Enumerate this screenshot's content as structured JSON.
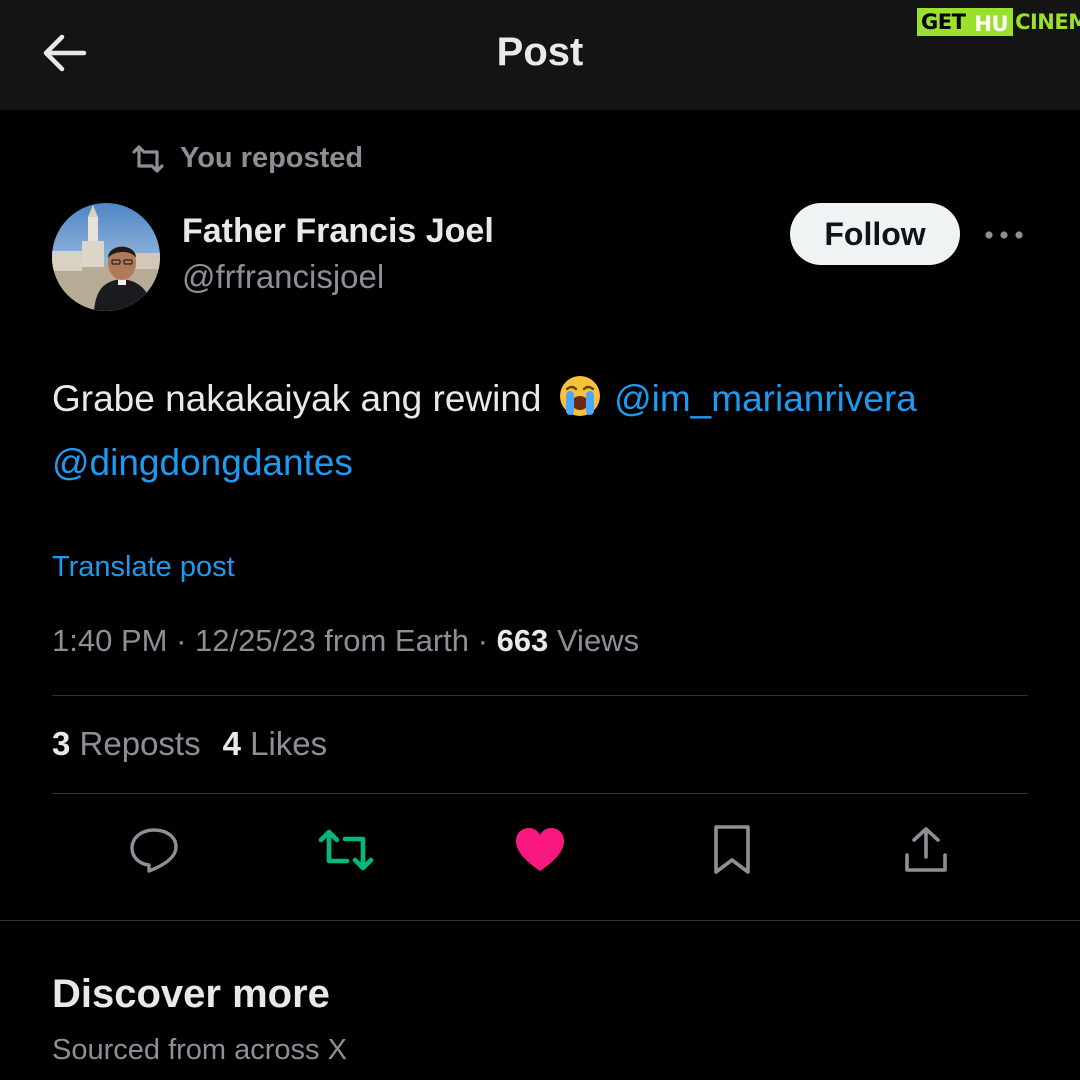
{
  "header": {
    "title": "Post",
    "back_icon": "arrow-left-icon"
  },
  "watermark": {
    "part_a": "GET",
    "part_b": "HU",
    "part_c": "CINEMA"
  },
  "repost_notice": {
    "text": "You reposted",
    "icon": "repost-icon"
  },
  "author": {
    "name": "Father Francis Joel",
    "handle": "@frfrancisjoel"
  },
  "follow_label": "Follow",
  "post": {
    "text": "Grabe nakakaiyak ang rewind",
    "emoji": "loudly-crying-face",
    "mentions": [
      "@im_marianrivera",
      "@dingdongdantes"
    ]
  },
  "translate_label": "Translate post",
  "meta": {
    "time": "1:40 PM",
    "date_source": "12/25/23 from Earth",
    "views_count": "663",
    "views_label": "Views"
  },
  "stats": {
    "reposts_count": "3",
    "reposts_label": "Reposts",
    "likes_count": "4",
    "likes_label": "Likes"
  },
  "actions": [
    {
      "name": "reply",
      "icon": "reply-icon",
      "active": false
    },
    {
      "name": "repost",
      "icon": "repost-icon",
      "active": true,
      "color": "#00ba7c"
    },
    {
      "name": "like",
      "icon": "heart-icon",
      "active": true,
      "color": "#f91880"
    },
    {
      "name": "bookmark",
      "icon": "bookmark-icon",
      "active": false
    },
    {
      "name": "share",
      "icon": "share-icon",
      "active": false
    }
  ],
  "discover": {
    "title": "Discover more",
    "subtitle": "Sourced from across X"
  },
  "colors": {
    "background": "#000000",
    "header_bg": "#141414",
    "link": "#1d9bf0",
    "muted": "#8b9096",
    "repost_active": "#00ba7c",
    "like_active": "#f91880"
  }
}
